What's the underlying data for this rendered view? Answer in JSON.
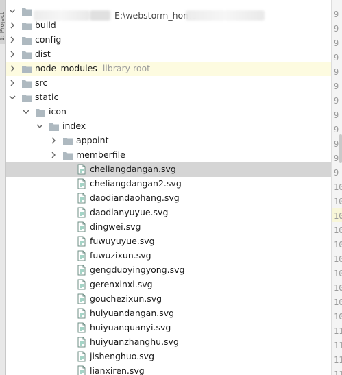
{
  "project_path": "E:\\webstorm_home",
  "strip_label": "1: Project",
  "tree": [
    {
      "label": "build",
      "hint": ""
    },
    {
      "label": "config",
      "hint": ""
    },
    {
      "label": "dist",
      "hint": ""
    },
    {
      "label": "node_modules",
      "hint": "library root"
    },
    {
      "label": "src",
      "hint": ""
    },
    {
      "label": "static",
      "hint": ""
    },
    {
      "label": "icon",
      "hint": ""
    },
    {
      "label": "index",
      "hint": ""
    },
    {
      "label": "appoint",
      "hint": ""
    },
    {
      "label": "memberfile",
      "hint": ""
    },
    {
      "label": "cheliangdangan.svg",
      "hint": ""
    },
    {
      "label": "cheliangdangan2.svg",
      "hint": ""
    },
    {
      "label": "daodiandaohang.svg",
      "hint": ""
    },
    {
      "label": "daodianyuyue.svg",
      "hint": ""
    },
    {
      "label": "dingwei.svg",
      "hint": ""
    },
    {
      "label": "fuwuyuyue.svg",
      "hint": ""
    },
    {
      "label": "fuwuzixun.svg",
      "hint": ""
    },
    {
      "label": "gengduoyingyong.svg",
      "hint": ""
    },
    {
      "label": "gerenxinxi.svg",
      "hint": ""
    },
    {
      "label": "gouchezixun.svg",
      "hint": ""
    },
    {
      "label": "huiyuandangan.svg",
      "hint": ""
    },
    {
      "label": "huiyuanquanyi.svg",
      "hint": ""
    },
    {
      "label": "huiyuanzhanghu.svg",
      "hint": ""
    },
    {
      "label": "jishenghuo.svg",
      "hint": ""
    },
    {
      "label": "lianxiren.svg",
      "hint": ""
    }
  ],
  "gutter_lines": [
    "9",
    "9",
    "9",
    "9",
    "9",
    "9",
    "9",
    "9",
    "9",
    "9",
    "9",
    "9",
    "10",
    "10",
    "10",
    "10",
    "10",
    "10",
    "10",
    "10",
    "10",
    "10",
    "11",
    "11",
    "11",
    "11"
  ]
}
